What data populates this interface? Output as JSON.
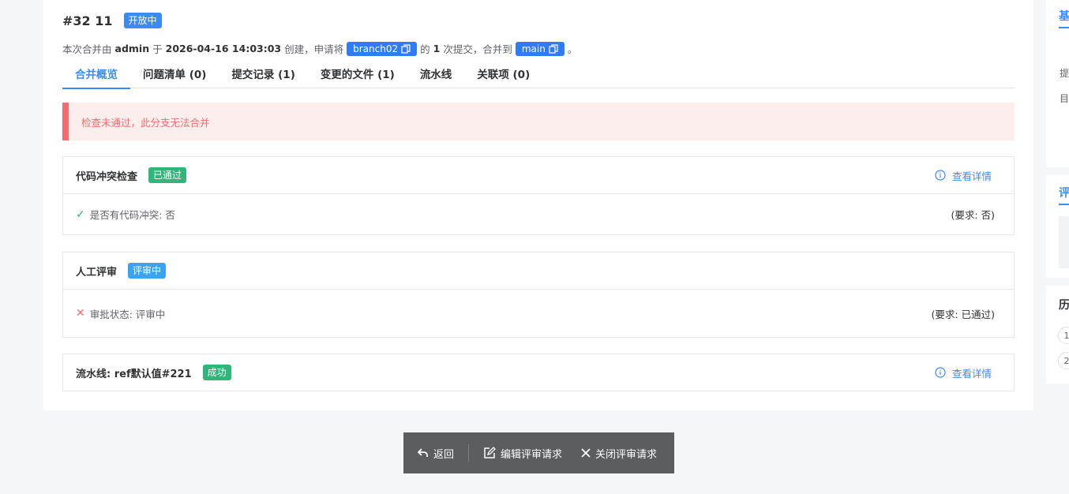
{
  "header": {
    "title": "#32 11",
    "status": "开放中"
  },
  "meta": {
    "prefix": "本次合并由",
    "author": "admin",
    "at_word": "于",
    "datetime": "2026-04-16 14:03:03",
    "created_text": "创建，申请将",
    "source_branch": "branch02",
    "of_word": "的",
    "commit_count": "1",
    "commit_text": "次提交，合并到",
    "target_branch": "main",
    "end": "。"
  },
  "tabs": [
    {
      "label": "合并概览",
      "active": true
    },
    {
      "label": "问题清单 (0)"
    },
    {
      "label": "提交记录 (1)"
    },
    {
      "label": "变更的文件 (1)"
    },
    {
      "label": "流水线"
    },
    {
      "label": "关联项 (0)"
    }
  ],
  "alert": {
    "text": "检查未通过，此分支无法合并"
  },
  "checks": {
    "conflict": {
      "name": "代码冲突检查",
      "badge": "已通过",
      "link": "查看详情",
      "item": "是否有代码冲突: 否",
      "requirement": "(要求: 否)"
    },
    "review": {
      "name": "人工评审",
      "badge": "评审中",
      "item": "审批状态: 评审中",
      "requirement": "(要求: 已通过)"
    },
    "pipeline": {
      "name": "流水线: ref默认值#221",
      "badge": "成功",
      "link": "查看详情"
    }
  },
  "side": {
    "basic_title": "基",
    "line1": "提",
    "line2": "目",
    "review_title": "评",
    "history_title": "历",
    "history_items": [
      "1",
      "2"
    ]
  },
  "actions": {
    "back": "返回",
    "edit": "编辑评审请求",
    "close": "关闭评审请求"
  },
  "colors": {
    "accent": "#3b8af5",
    "success": "#2fb678",
    "danger": "#f56c6c",
    "info": "#3aa4f2"
  }
}
